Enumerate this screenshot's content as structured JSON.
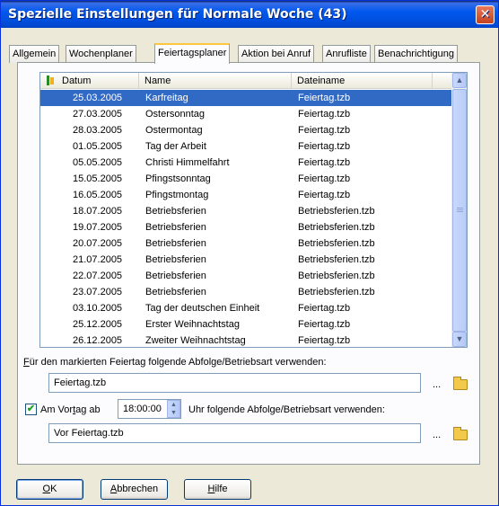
{
  "window": {
    "title": "Spezielle Einstellungen für Normale Woche (43)",
    "close_glyph": "✕"
  },
  "tabs": [
    {
      "label": "Allgemein"
    },
    {
      "label": "Wochenplaner"
    },
    {
      "label": "Feiertagsplaner",
      "active": true
    },
    {
      "label": "Aktion bei Anruf"
    },
    {
      "label": "Anrufliste"
    },
    {
      "label": "Benachrichtigung"
    }
  ],
  "table": {
    "columns": [
      "Datum",
      "Name",
      "Dateiname"
    ],
    "selected_index": 0,
    "rows": [
      {
        "date": "25.03.2005",
        "name": "Karfreitag",
        "file": "Feiertag.tzb"
      },
      {
        "date": "27.03.2005",
        "name": "Ostersonntag",
        "file": "Feiertag.tzb"
      },
      {
        "date": "28.03.2005",
        "name": "Ostermontag",
        "file": "Feiertag.tzb"
      },
      {
        "date": "01.05.2005",
        "name": "Tag der Arbeit",
        "file": "Feiertag.tzb"
      },
      {
        "date": "05.05.2005",
        "name": "Christi Himmelfahrt",
        "file": "Feiertag.tzb"
      },
      {
        "date": "15.05.2005",
        "name": "Pfingstsonntag",
        "file": "Feiertag.tzb"
      },
      {
        "date": "16.05.2005",
        "name": "Pfingstmontag",
        "file": "Feiertag.tzb"
      },
      {
        "date": "18.07.2005",
        "name": "Betriebsferien",
        "file": "Betriebsferien.tzb"
      },
      {
        "date": "19.07.2005",
        "name": "Betriebsferien",
        "file": "Betriebsferien.tzb"
      },
      {
        "date": "20.07.2005",
        "name": "Betriebsferien",
        "file": "Betriebsferien.tzb"
      },
      {
        "date": "21.07.2005",
        "name": "Betriebsferien",
        "file": "Betriebsferien.tzb"
      },
      {
        "date": "22.07.2005",
        "name": "Betriebsferien",
        "file": "Betriebsferien.tzb"
      },
      {
        "date": "23.07.2005",
        "name": "Betriebsferien",
        "file": "Betriebsferien.tzb"
      },
      {
        "date": "03.10.2005",
        "name": "Tag der deutschen Einheit",
        "file": "Feiertag.tzb"
      },
      {
        "date": "25.12.2005",
        "name": "Erster Weihnachtstag",
        "file": "Feiertag.tzb"
      },
      {
        "date": "26.12.2005",
        "name": "Zweiter Weihnachtstag",
        "file": "Feiertag.tzb"
      }
    ]
  },
  "holiday_sequence": {
    "label_accel": "F",
    "label_rest": "ür den markierten Feiertag folgende Abfolge/Betriebsart verwenden:",
    "value": "Feiertag.tzb",
    "browse_dots": "..."
  },
  "eve_sequence": {
    "checked": true,
    "check_glyph": "✔",
    "label_pre": "Am Vor",
    "label_accel": "t",
    "label_post": "ag ab",
    "time": "18:00:00",
    "label_after": "Uhr folgende Abfolge/Betriebsart verwenden:",
    "value": "Vor Feiertag.tzb",
    "browse_dots": "..."
  },
  "buttons": {
    "ok_accel": "O",
    "ok_rest": "K",
    "cancel_accel": "A",
    "cancel_rest": "bbrechen",
    "help_accel": "H",
    "help_rest": "ilfe"
  },
  "icons": {
    "scroll_up": "▲",
    "scroll_down": "▼",
    "spin_up": "▲",
    "spin_down": "▼"
  }
}
